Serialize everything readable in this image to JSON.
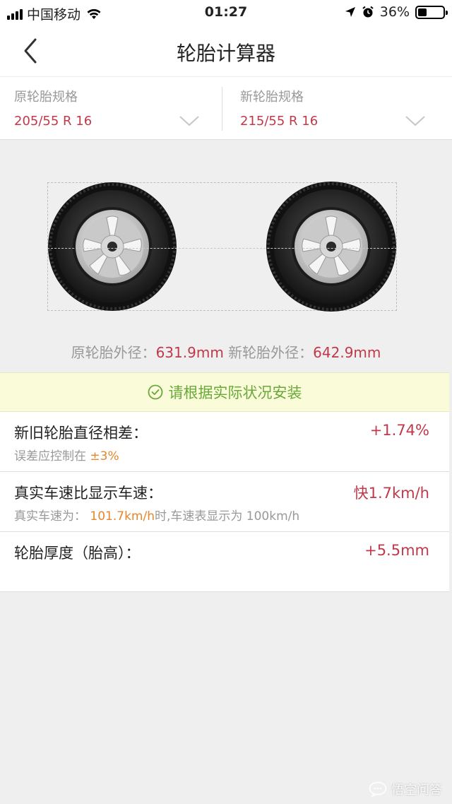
{
  "status_bar": {
    "carrier": "中国移动",
    "time": "01:27",
    "battery": "36%",
    "battery_level": 0.36
  },
  "nav": {
    "title": "轮胎计算器",
    "back_icon": "chevron-left-icon"
  },
  "specs": {
    "original": {
      "label": "原轮胎规格",
      "value": "205/55 R 16"
    },
    "new": {
      "label": "新轮胎规格",
      "value": "215/55 R 16"
    }
  },
  "diameters": {
    "original_label": "原轮胎外径：",
    "original_value": "631.9mm",
    "new_label": "新轮胎外径：",
    "new_value": "642.9mm"
  },
  "notice": {
    "icon": "check-circle-icon",
    "text": "请根据实际状况安装"
  },
  "results": [
    {
      "title": "新旧轮胎直径相差：",
      "value": "+1.74%",
      "sub_prefix": "误差应控制在",
      "sub_highlight": "±3%",
      "sub_suffix": ""
    },
    {
      "title": "真实车速比显示车速：",
      "value": "快1.7km/h",
      "sub_prefix": "真实车速为：",
      "sub_highlight": "101.7km/h",
      "sub_suffix": "时,车速表显示为 100km/h"
    },
    {
      "title": "轮胎厚度（胎高）：",
      "value": "+5.5mm"
    }
  ],
  "watermark": "悟空问答",
  "colors": {
    "accent_red": "#c0394b",
    "highlight_orange": "#e6862a",
    "notice_green": "#6aa83a",
    "notice_bg": "#fafbd9"
  }
}
